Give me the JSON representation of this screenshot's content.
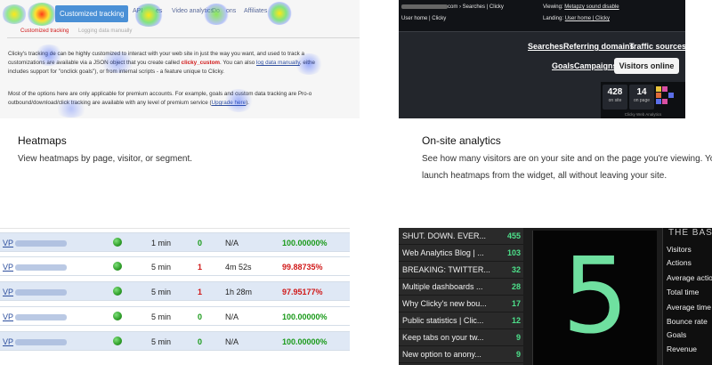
{
  "features": [
    {
      "title": "Heatmaps",
      "description": "View heatmaps by page, visitor, or segment."
    },
    {
      "title": "On-site analytics",
      "description_line1": "See how many visitors are on your site and on the page you're viewing. You",
      "description_line2": "launch heatmaps from the widget, all without leaving your site."
    }
  ],
  "heatmap_screenshot": {
    "nav_items": [
      "Customized tracking",
      "API",
      "es",
      "Video analytics",
      "Do",
      "ons",
      "Affiliates"
    ],
    "subnav": [
      "Customized tracking",
      "Logging data manually"
    ],
    "para1_a": "Clicky's tracking ",
    "para1_b": "de can be highly customized to interact with your web site in just the way you want, and used to track a",
    "para1_c": "customizations are available via a JSON object that you create called ",
    "para1_red": "clicky_custom",
    "para1_d": ". You can also ",
    "para1_link": "log data manually",
    "para1_e": ", eithe",
    "para1_f": "includes support for \"onclick goals\"), or from internal scripts - a feature unique to Clicky.",
    "para2_a": "Most of the options here are only applicable for premium accounts. For example, goals and custom data tracking are Pro-o",
    "para2_b": "outbound/download/click tracking are available with any level of premium service (",
    "para2_link": "Upgrade here",
    "para2_c": ").",
    "blob_colors": [
      "#ffdd00",
      "#4de04d",
      "#3050ff"
    ]
  },
  "onsite_screenshot": {
    "top_left_1_suffix": "com › Searches | Clicky",
    "top_left_2": "User home | Clicky",
    "viewing_label": "Viewing:",
    "viewing_value": "Metapzy sound disable",
    "landing_label": "Landing:",
    "landing_value": "User home | Clicky",
    "links_row1": [
      "Searches",
      "Referring domains",
      "Traffic sources"
    ],
    "links_row2": [
      "Goals",
      "Campaigns"
    ],
    "visitors_online_button": "Visitors online",
    "stats": [
      {
        "value": "428",
        "label": "on site"
      },
      {
        "value": "14",
        "label": "on page"
      }
    ],
    "widget_footer": "Clicky Web Analytics"
  },
  "visitors_table": {
    "rows": [
      {
        "visitor": "VP",
        "time": "1 min",
        "actions": "0",
        "duration": "N/A",
        "percent": "100.00000%",
        "actions_color": "#1a9a1a",
        "percent_color": "#1a9a1a"
      },
      {
        "visitor": "VP",
        "time": "5 min",
        "actions": "1",
        "duration": "4m 52s",
        "percent": "99.88735%",
        "actions_color": "#d01818",
        "percent_color": "#d01818"
      },
      {
        "visitor": "VP",
        "time": "5 min",
        "actions": "1",
        "duration": "1h 28m",
        "percent": "97.95177%",
        "actions_color": "#d01818",
        "percent_color": "#d01818"
      },
      {
        "visitor": "VP",
        "time": "5 min",
        "actions": "0",
        "duration": "N/A",
        "percent": "100.00000%",
        "actions_color": "#1a9a1a",
        "percent_color": "#1a9a1a"
      },
      {
        "visitor": "VP",
        "time": "5 min",
        "actions": "0",
        "duration": "N/A",
        "percent": "100.00000%",
        "actions_color": "#1a9a1a",
        "percent_color": "#1a9a1a"
      }
    ]
  },
  "dashboard": {
    "items": [
      {
        "title": "SHUT. DOWN. EVER...",
        "count": "455"
      },
      {
        "title": "Web Analytics Blog | ...",
        "count": "103"
      },
      {
        "title": "BREAKING: TWITTER...",
        "count": "32"
      },
      {
        "title": "Multiple dashboards ...",
        "count": "28"
      },
      {
        "title": "Why Clicky's new bou...",
        "count": "17"
      },
      {
        "title": "Public statistics | Clic...",
        "count": "12"
      },
      {
        "title": "Keep tabs on your tw...",
        "count": "9"
      },
      {
        "title": "New option to anony...",
        "count": "9"
      }
    ],
    "big_number": "5",
    "metrics_heading": "THE BAS",
    "metrics": [
      "Visitors",
      "Actions",
      "Average actio",
      "Total time",
      "Average time",
      "Bounce rate",
      "Goals",
      "Revenue"
    ],
    "number_color": "#6fe0a0"
  }
}
